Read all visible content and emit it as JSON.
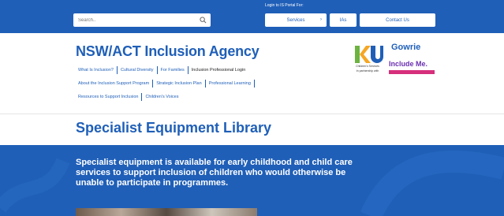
{
  "topbar": {
    "login_link": "Login to IS Portal For:",
    "search_placeholder": "Search..",
    "services_label": "Services",
    "ias_label": "IAs",
    "contact_label": "Contact Us"
  },
  "brand": {
    "title": "NSW/ACT Inclusion Agency"
  },
  "menu": {
    "row1": [
      "What Is Inclusion?",
      "Cultural Diversity",
      "For Families",
      "Inclusion Professional Login"
    ],
    "row2": [
      "About the Inclusion Support Program",
      "Strategic Inclusion Plan",
      "Professional Learning"
    ],
    "row3": [
      "Resources to Support Inclusion",
      "Children's Voices"
    ]
  },
  "logos": {
    "ku_label": "Children's Services",
    "ku_sub": "In partnership with",
    "gowrie": "Gowrie",
    "include": "Include Me."
  },
  "page": {
    "heading": "Specialist Equipment Library",
    "hero_text": "Specialist equipment is available for early childhood and child care services to support inclusion of children who would otherwise be unable to participate in programmes."
  },
  "colors": {
    "brand_blue": "#1f5fb8",
    "white": "#ffffff"
  }
}
